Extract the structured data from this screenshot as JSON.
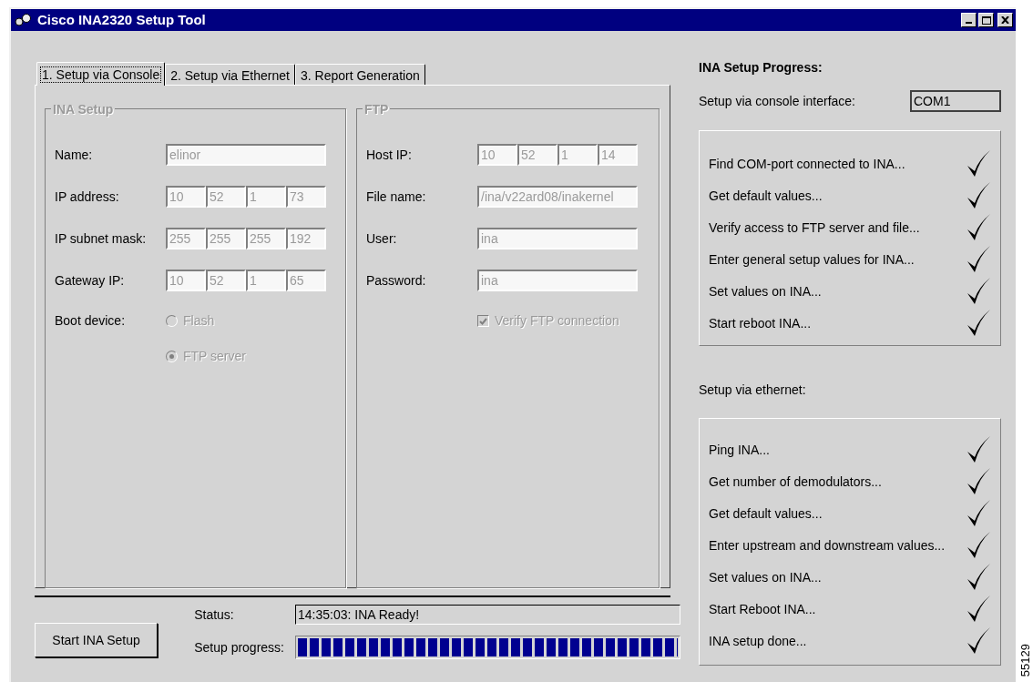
{
  "window": {
    "title": "Cisco INA2320 Setup Tool"
  },
  "tabs": [
    {
      "label": "1. Setup via Console",
      "selected": true
    },
    {
      "label": "2. Setup via Ethernet",
      "selected": false
    },
    {
      "label": "3. Report Generation",
      "selected": false
    }
  ],
  "ina_setup": {
    "title": "INA Setup",
    "disabled": true,
    "fields": [
      {
        "label": "Name:",
        "kind": "text",
        "value": "elinor"
      },
      {
        "label": "IP address:",
        "kind": "ip",
        "values": [
          "10",
          "52",
          "1",
          "73"
        ]
      },
      {
        "label": "IP subnet mask:",
        "kind": "ip",
        "values": [
          "255",
          "255",
          "255",
          "192"
        ]
      },
      {
        "label": "Gateway IP:",
        "kind": "ip",
        "values": [
          "10",
          "52",
          "1",
          "65"
        ]
      }
    ],
    "boot_device": {
      "label": "Boot device:",
      "options": [
        {
          "label": "Flash",
          "selected": false
        },
        {
          "label": "FTP server",
          "selected": true
        }
      ]
    }
  },
  "ftp": {
    "title": "FTP",
    "disabled": true,
    "fields": [
      {
        "label": "Host IP:",
        "kind": "ip",
        "values": [
          "10",
          "52",
          "1",
          "14"
        ]
      },
      {
        "label": "File name:",
        "kind": "text",
        "value": "/ina/v22ard08/inakernel"
      },
      {
        "label": "User:",
        "kind": "text",
        "value": "ina"
      },
      {
        "label": "Password:",
        "kind": "text",
        "value": "ina"
      }
    ],
    "verify": {
      "label": "Verify FTP connection",
      "checked": true
    }
  },
  "start_button": {
    "label": "Start INA Setup"
  },
  "status": {
    "label": "Status:",
    "value": "14:35:03: INA Ready!"
  },
  "setup_progress": {
    "label": "Setup progress:",
    "level": 1
  },
  "progress_panel": {
    "title": "INA Setup Progress:",
    "console": {
      "label": "Setup via console interface:",
      "port": "COM1"
    },
    "console_steps": [
      {
        "label": "Find COM-port connected to INA...",
        "done": true
      },
      {
        "label": "Get default values...",
        "done": true
      },
      {
        "label": "Verify access to FTP server and file...",
        "done": true
      },
      {
        "label": "Enter general setup values for INA...",
        "done": true
      },
      {
        "label": "Set values on INA...",
        "done": true
      },
      {
        "label": "Start reboot INA...",
        "done": true
      }
    ],
    "ethernet": {
      "label": "Setup via ethernet:"
    },
    "ethernet_steps": [
      {
        "label": "Ping INA...",
        "done": true
      },
      {
        "label": "Get number of demodulators...",
        "done": true
      },
      {
        "label": "Get default values...",
        "done": true
      },
      {
        "label": "Enter upstream and downstream values...",
        "done": true
      },
      {
        "label": "Set values on INA...",
        "done": true
      },
      {
        "label": "Start Reboot INA...",
        "done": true
      },
      {
        "label": "INA setup done...",
        "done": true
      }
    ]
  },
  "figure_number": "55129"
}
